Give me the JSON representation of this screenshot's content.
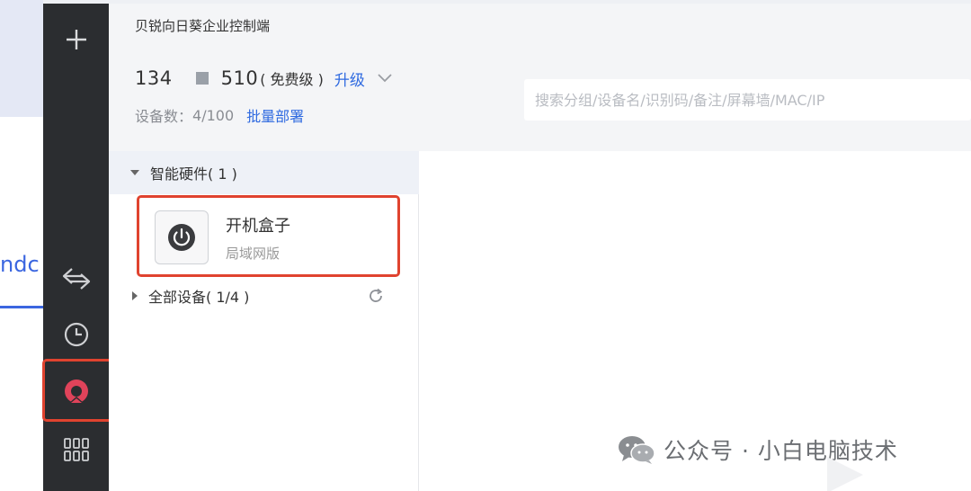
{
  "background_page": {
    "partial_text": "ndc"
  },
  "rail": {
    "items": [
      {
        "name": "add",
        "icon": "plus-icon"
      },
      {
        "name": "transfer",
        "icon": "swap-arrows-icon"
      },
      {
        "name": "history",
        "icon": "clock-icon"
      },
      {
        "name": "remote-control",
        "icon": "sunlogin-logo-icon",
        "active": true,
        "accent": "#e0435a"
      },
      {
        "name": "apps",
        "icon": "grid-icon"
      }
    ]
  },
  "header": {
    "app_title": "贝锐向日葵企业控制端",
    "account_prefix": "134",
    "account_suffix": "510",
    "account_tier": "( 免费级 )",
    "upgrade_label": "升级",
    "device_count_label": "设备数：",
    "device_count_value": "4/100",
    "batch_deploy_label": "批量部署"
  },
  "search": {
    "placeholder": "搜索分组/设备名/识别码/备注/屏幕墙/MAC/IP"
  },
  "tree": {
    "group_label": "智能硬件( 1 )",
    "devices": [
      {
        "name": "开机盒子",
        "type": "局域网版",
        "icon": "power-icon"
      }
    ],
    "all_devices_label": "全部设备( 1/4 )"
  },
  "watermark": {
    "text": "公众号 · 小白电脑技术",
    "icon": "wechat-icon"
  },
  "colors": {
    "accent": "#2f6ae0",
    "highlight": "#e0432f",
    "rail": "#2b2d30"
  }
}
